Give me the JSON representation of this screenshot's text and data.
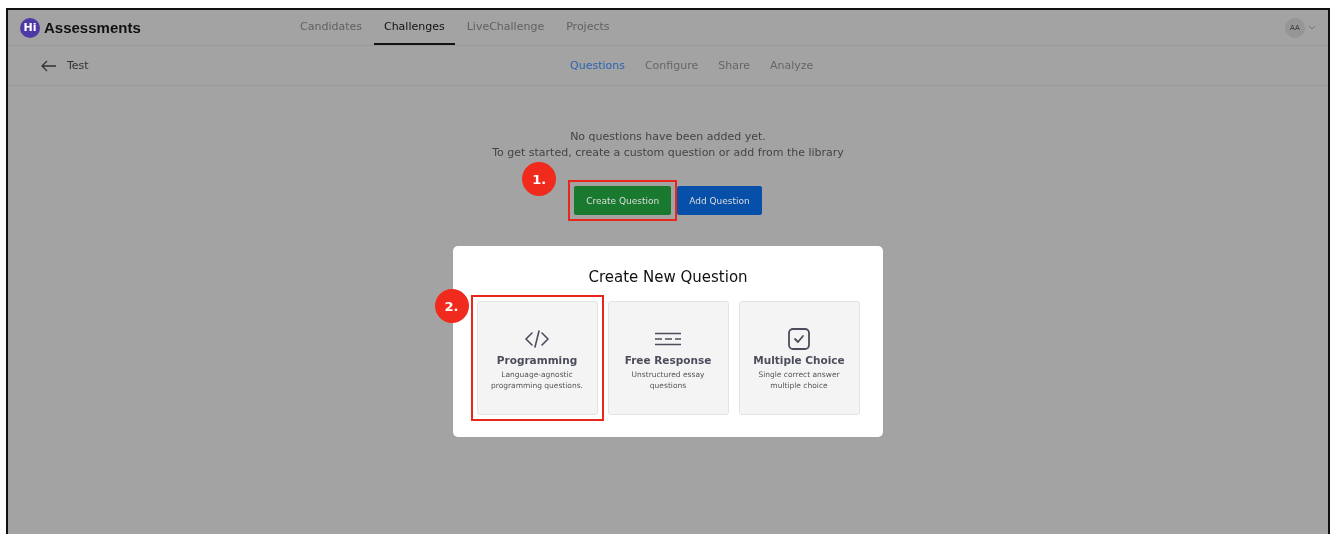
{
  "header": {
    "logo_badge": "Hi",
    "logo_text": "Assessments",
    "avatar": "AA"
  },
  "nav_tabs": [
    {
      "label": "Candidates",
      "selected": false
    },
    {
      "label": "Challenges",
      "selected": true
    },
    {
      "label": "LiveChallenge",
      "selected": false
    },
    {
      "label": "Projects",
      "selected": false
    }
  ],
  "sub_header": {
    "back_label": "Test"
  },
  "sub_tabs": [
    {
      "label": "Questions",
      "selected": true
    },
    {
      "label": "Configure",
      "selected": false
    },
    {
      "label": "Share",
      "selected": false
    },
    {
      "label": "Analyze",
      "selected": false
    }
  ],
  "empty_state": {
    "lines": [
      "No questions have been added yet.",
      "To get started, create a custom question or add from the library"
    ]
  },
  "buttons": [
    {
      "label": "Create Question",
      "kind": "create",
      "annotation": "1."
    },
    {
      "label": "Add Question",
      "kind": "add"
    }
  ],
  "modal": {
    "title": "Create New Question",
    "cards": [
      {
        "kind": "code",
        "title": "Programming",
        "description": "Language-agnostic programming questions.",
        "annotation": "2."
      },
      {
        "kind": "text",
        "title": "Free Response",
        "description": "Unstructured essay questions"
      },
      {
        "kind": "check",
        "title": "Multiple Choice",
        "description": "Single correct answer multiple choice"
      }
    ]
  }
}
